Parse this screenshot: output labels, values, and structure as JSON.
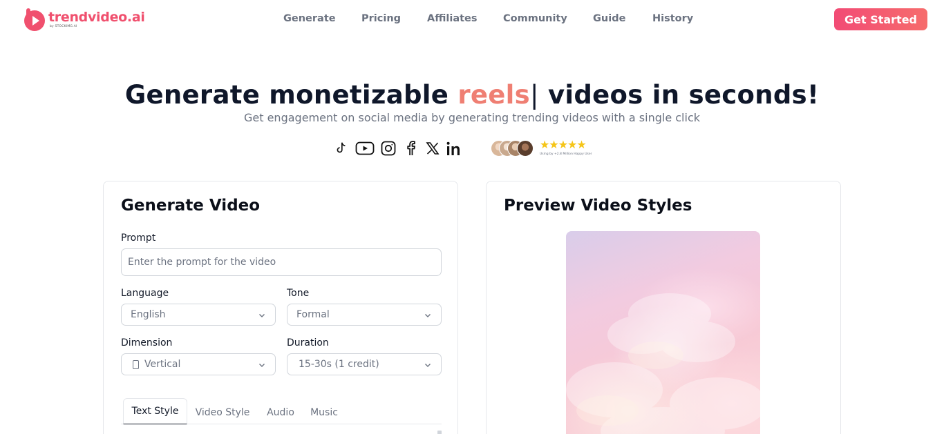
{
  "brand": {
    "name": "trendvideo.ai",
    "byline": "by STOCKIMG.AI",
    "color": "#f0506e"
  },
  "nav": {
    "items": [
      "Generate",
      "Pricing",
      "Affiliates",
      "Community",
      "Guide",
      "History"
    ],
    "cta_label": "Get Started"
  },
  "hero": {
    "title_before": "Generate monetizable ",
    "title_accent": "reels",
    "title_cursor": "|",
    "title_after": " videos in seconds!",
    "subtitle": "Get engagement on social media by generating trending videos with a single click",
    "accent_color": "#ef7f73"
  },
  "socials": [
    "tiktok-icon",
    "youtube-icon",
    "instagram-icon",
    "facebook-icon",
    "x-icon",
    "linkedin-icon"
  ],
  "social_proof": {
    "stars": "★★★★★",
    "text": "Using by +2.8 Million Happy User"
  },
  "generate": {
    "title": "Generate Video",
    "prompt_label": "Prompt",
    "prompt_value": "",
    "prompt_placeholder": "Enter the prompt for the video",
    "language_label": "Language",
    "language_value": "English",
    "tone_label": "Tone",
    "tone_value": "Formal",
    "dimension_label": "Dimension",
    "dimension_value": "Vertical",
    "duration_label": "Duration",
    "duration_value": "15-30s (1 credit)",
    "tabs": [
      {
        "label": "Text Style",
        "active": true
      },
      {
        "label": "Video Style",
        "active": false
      },
      {
        "label": "Audio",
        "active": false
      },
      {
        "label": "Music",
        "active": false
      }
    ]
  },
  "preview": {
    "title": "Preview Video Styles"
  }
}
